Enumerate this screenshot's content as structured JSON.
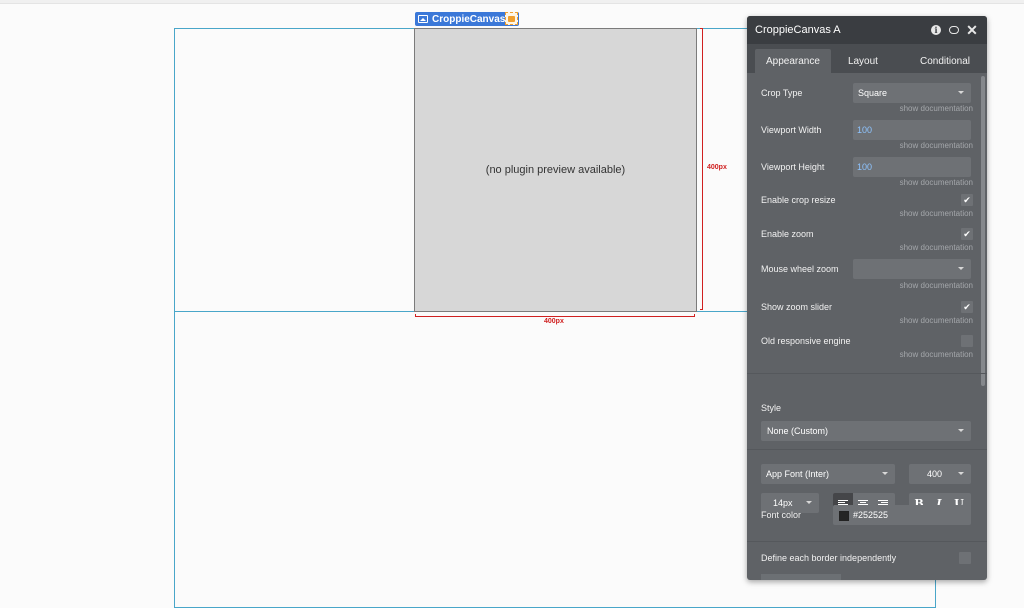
{
  "element": {
    "name": "CroppieCanvas A",
    "preview_text": "(no plugin preview available)",
    "height_label": "400px",
    "width_label": "400px"
  },
  "panel": {
    "title": "CroppieCanvas A",
    "tabs": [
      {
        "label": "Appearance",
        "active": true
      },
      {
        "label": "Layout",
        "active": false
      },
      {
        "label": "Conditional",
        "active": false
      }
    ],
    "doc_link": "show documentation",
    "properties": {
      "crop_type": {
        "label": "Crop Type",
        "value": "Square"
      },
      "viewport_width": {
        "label": "Viewport Width",
        "value": "100"
      },
      "viewport_height": {
        "label": "Viewport Height",
        "value": "100"
      },
      "enable_crop_resize": {
        "label": "Enable crop resize",
        "checked": true
      },
      "enable_zoom": {
        "label": "Enable zoom",
        "checked": true
      },
      "mouse_wheel_zoom": {
        "label": "Mouse wheel zoom",
        "value": ""
      },
      "show_zoom_slider": {
        "label": "Show zoom slider",
        "checked": true
      },
      "old_responsive_engine": {
        "label": "Old responsive engine",
        "checked": false
      }
    },
    "style": {
      "label": "Style",
      "value": "None (Custom)"
    },
    "font": {
      "family": "App Font (Inter)",
      "weight": "400",
      "size": "14px",
      "color_label": "Font color",
      "color_value": "#252525"
    },
    "border": {
      "label": "Define each border independently",
      "checked": false
    }
  },
  "colors": {
    "accent_blue": "#3b78d8",
    "outline_blue": "#49a6c9",
    "dimension_red": "#d02020",
    "panel_bg": "#5f6266",
    "panel_header": "#3a3d41"
  }
}
